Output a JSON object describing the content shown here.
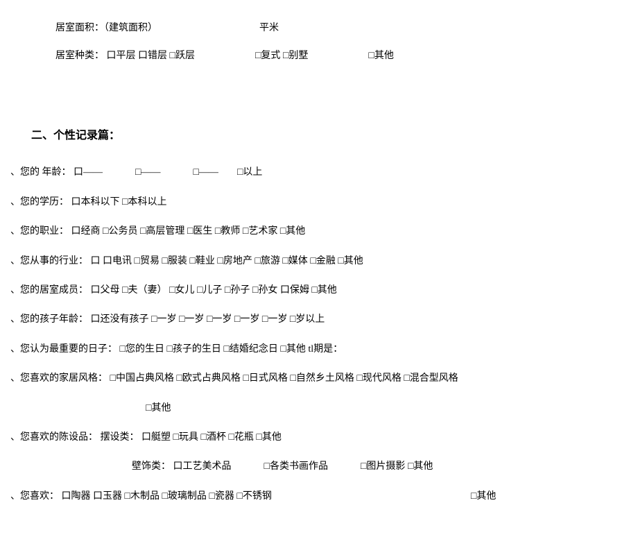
{
  "room": {
    "area_label": "居室面积：（建筑面积）",
    "area_unit": "平米",
    "type_label": "居室种类：",
    "flat": "口平层",
    "split": "口错层",
    "skip": "□跃层",
    "duplex": "□复式",
    "villa": "□别墅",
    "other": "□其他"
  },
  "section2": {
    "title": "二、个性记录篇：",
    "q1": {
      "label": "、您的 年龄：",
      "o1": "口——",
      "o2": "□——",
      "o3": "□——",
      "o4": "□以上"
    },
    "q2": {
      "label": "、您的学历：",
      "o1": "口本科以下",
      "o2": "□本科以上"
    },
    "q3": {
      "label": "、您的职业：",
      "o1": "口经商",
      "o2": "□公务员",
      "o3": "□高层管理",
      "o4": "□医生",
      "o5": "□教师",
      "o6": "□艺术家",
      "o7": "□其他"
    },
    "q4": {
      "label": "、您从事的行业：",
      "o1": "口",
      "o2": "口电讯",
      "o3": "□贸易",
      "o4": "□服装",
      "o5": "□鞋业",
      "o6": "□房地产",
      "o7": "□旅游",
      "o8": "□媒体",
      "o9": "□金融",
      "o10": "□其他"
    },
    "q5": {
      "label": "、您的居室成员：",
      "o1": "口父母",
      "o2": "□夫（妻）",
      "o3": "□女儿",
      "o4": "□儿子",
      "o5": "□孙子",
      "o6": "□孙女",
      "o7": "口保姆",
      "o8": "□其他"
    },
    "q6": {
      "label": "、您的孩子年龄：",
      "o1": "口还没有孩子",
      "o2": "□一岁",
      "o3": "□一岁",
      "o4": "□一岁",
      "o5": "□一岁",
      "o6": "□一岁",
      "o7": "□岁以上"
    },
    "q7": {
      "label": "、您认为最重要的日子：",
      "o1": "□您的生日",
      "o2": "□孩子的生日",
      "o3": "□结婚纪念日",
      "o4": "□其他",
      "o5": "tl期是："
    },
    "q8": {
      "label": "、您喜欢的家居风格：",
      "o1": "□中国占典风格",
      "o2": "□欧式占典风格",
      "o3": "□日式风格",
      "o4": "□自然乡土风格",
      "o5": "□现代风格",
      "o6": "□混合型风格",
      "o7": "□其他"
    },
    "q9": {
      "label": "、您喜欢的陈设品：",
      "sub1_label": "摆设类：",
      "s1o1": "口艇塑",
      "s1o2": "□玩具",
      "s1o3": "□酒杯",
      "s1o4": "□花瓶",
      "s1o5": "□其他",
      "sub2_label": "壁饰类：",
      "s2o1": "口工艺美术品",
      "s2o2": "□各类书画作品",
      "s2o3": "□图片摄影",
      "s2o4": "□其他"
    },
    "q10": {
      "label": "、您喜欢：",
      "o1": "口陶器",
      "o2": "口玉器",
      "o3": "□木制品",
      "o4": "□玻璃制品",
      "o5": "□瓷器",
      "o6": "□不锈钢",
      "o7": "□其他"
    }
  }
}
